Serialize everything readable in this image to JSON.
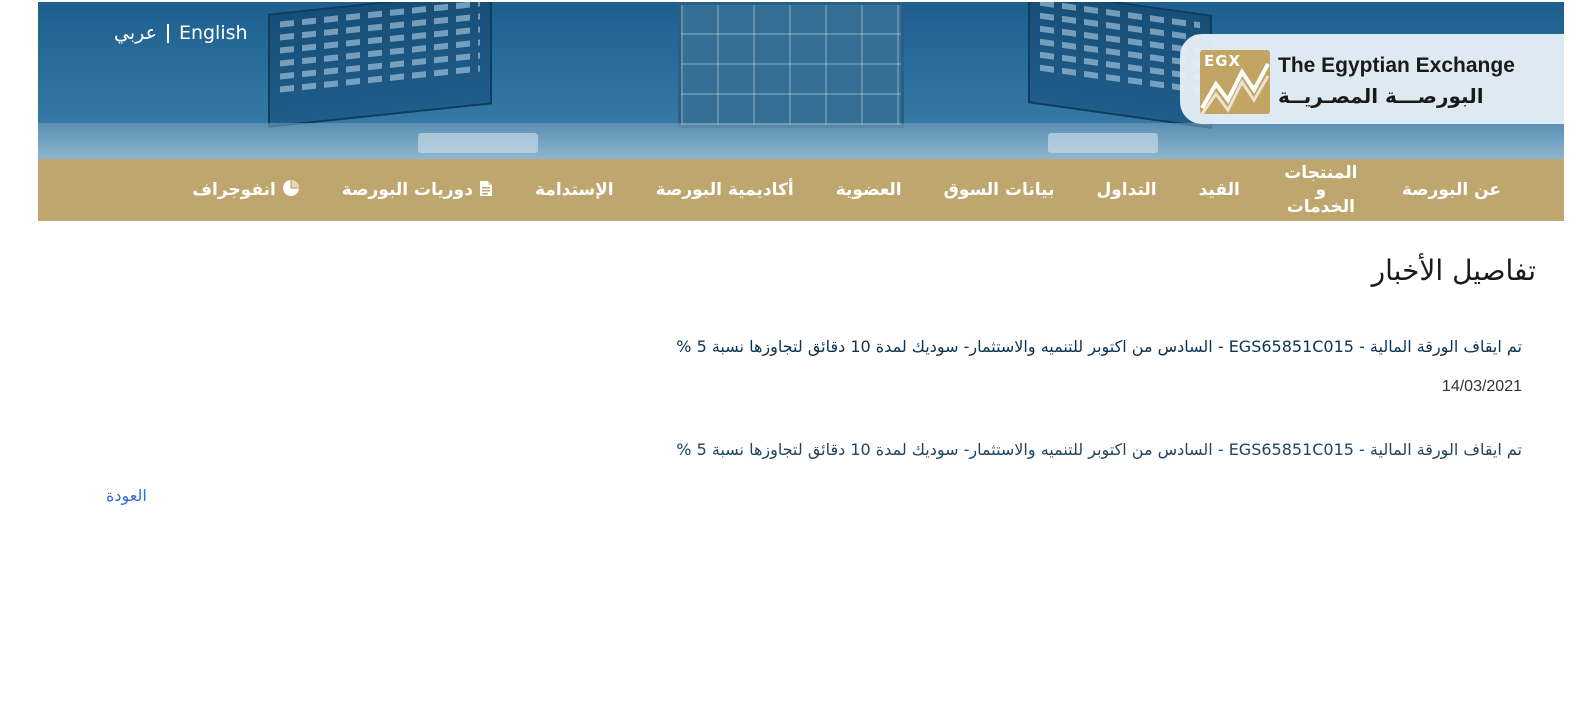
{
  "header": {
    "lang_ar": "عربي",
    "lang_en": "English",
    "logo_mark_text": "EGX",
    "logo_en": "The Egyptian Exchange",
    "logo_ar": "البورصـــة المصـريــة"
  },
  "nav": {
    "items": [
      "عن البورصة",
      "المنتجات و الخدمات",
      "القيد",
      "التداول",
      "بيانات السوق",
      "العضوية",
      "أكاديمية البورصة",
      "الإستدامة",
      "دوريات البورصة",
      "انفوجراف"
    ],
    "icons": {
      "publications": "document-icon",
      "infograph": "pie-chart-icon"
    }
  },
  "content": {
    "page_title": "تفاصيل الأخبار",
    "news_title": "تم ايقاف الورقة المالية - EGS65851C015 - السادس من اكتوبر للتنميه والاستثمار- سوديك لمدة 10 دقائق لتجاوزها نسبة 5 %",
    "news_date": "14/03/2021",
    "news_body": "تم ايقاف الورقة المالية - EGS65851C015 - السادس من اكتوبر للتنميه والاستثمار- سوديك لمدة 10 دقائق لتجاوزها نسبة 5 %",
    "back_label": "العودة"
  },
  "colors": {
    "nav_bg": "#bea66e",
    "banner_blue": "#2a6f9d",
    "title_blue": "#0b3352",
    "link_blue": "#2f6fd0"
  }
}
